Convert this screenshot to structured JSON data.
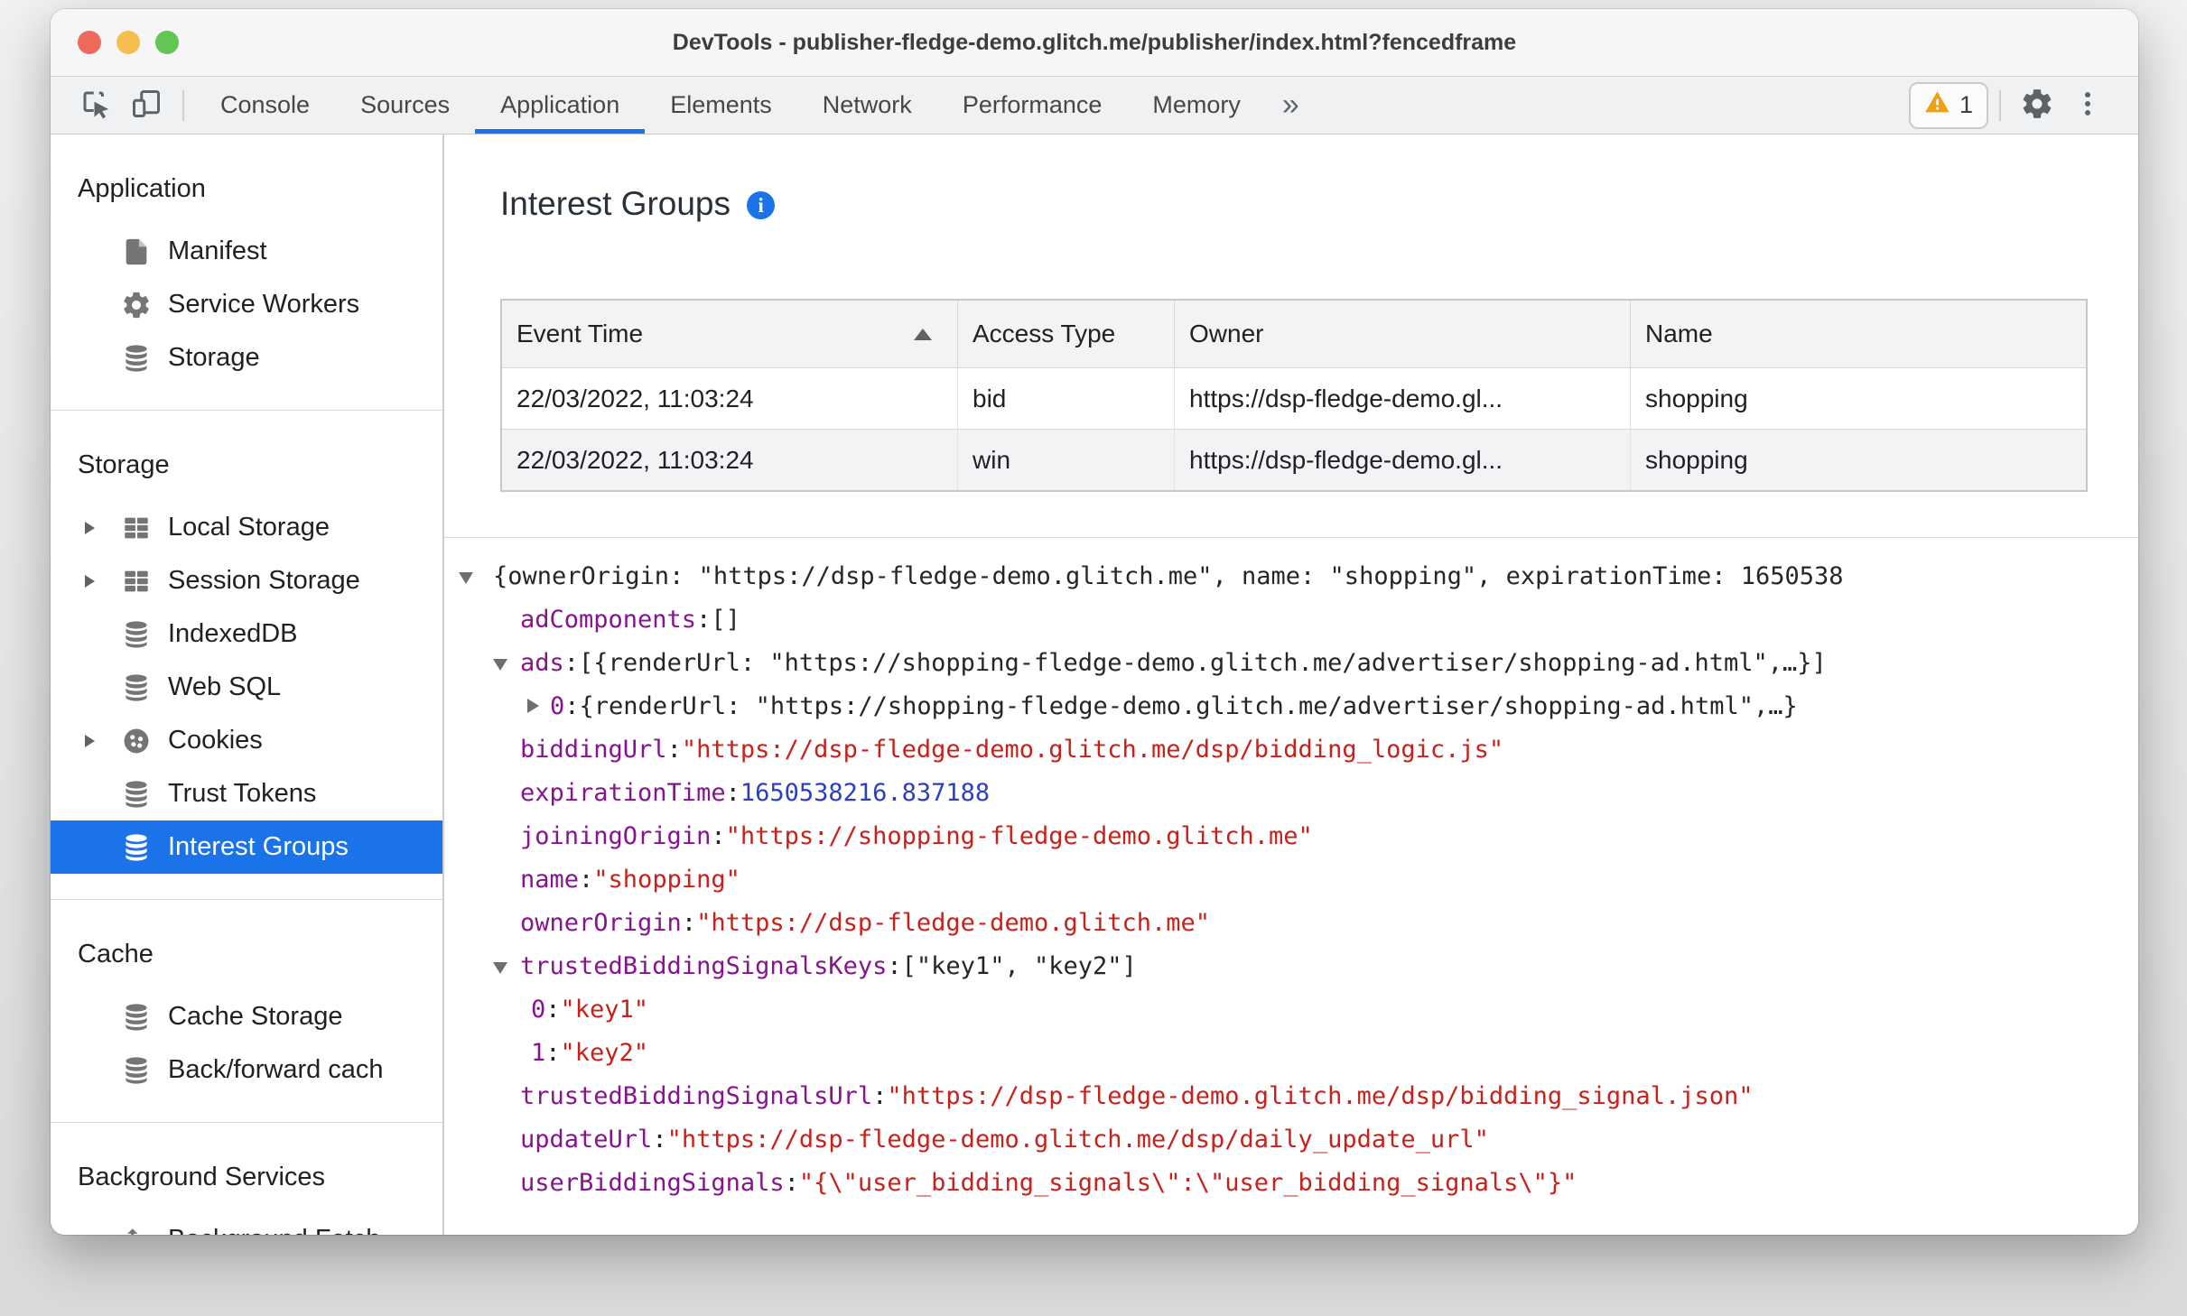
{
  "window": {
    "title": "DevTools - publisher-fledge-demo.glitch.me/publisher/index.html?fencedframe"
  },
  "toolbar": {
    "tabs": [
      {
        "label": "Console"
      },
      {
        "label": "Sources"
      },
      {
        "label": "Application",
        "selected": true
      },
      {
        "label": "Elements"
      },
      {
        "label": "Network"
      },
      {
        "label": "Performance"
      },
      {
        "label": "Memory"
      }
    ],
    "more_tabs_symbol": "»",
    "warning_badge_count": "1"
  },
  "sidebar": {
    "sections": [
      {
        "title": "Application",
        "items": [
          {
            "label": "Manifest",
            "icon": "document"
          },
          {
            "label": "Service Workers",
            "icon": "gear"
          },
          {
            "label": "Storage",
            "icon": "database"
          }
        ]
      },
      {
        "title": "Storage",
        "items": [
          {
            "label": "Local Storage",
            "icon": "grid",
            "expander": true
          },
          {
            "label": "Session Storage",
            "icon": "grid",
            "expander": true
          },
          {
            "label": "IndexedDB",
            "icon": "database"
          },
          {
            "label": "Web SQL",
            "icon": "database"
          },
          {
            "label": "Cookies",
            "icon": "cookie",
            "expander": true
          },
          {
            "label": "Trust Tokens",
            "icon": "database"
          },
          {
            "label": "Interest Groups",
            "icon": "database",
            "selected": true
          }
        ]
      },
      {
        "title": "Cache",
        "items": [
          {
            "label": "Cache Storage",
            "icon": "database"
          },
          {
            "label": "Back/forward cach",
            "icon": "database"
          }
        ]
      },
      {
        "title": "Background Services",
        "items": [
          {
            "label": "Background Fetch",
            "icon": "updown"
          }
        ]
      }
    ]
  },
  "main": {
    "heading": "Interest Groups",
    "table": {
      "columns": [
        {
          "label": "Event Time",
          "sorted": "asc"
        },
        {
          "label": "Access Type"
        },
        {
          "label": "Owner"
        },
        {
          "label": "Name"
        }
      ],
      "rows": [
        [
          "22/03/2022, 11:03:24",
          "bid",
          "https://dsp-fledge-demo.gl...",
          "shopping"
        ],
        [
          "22/03/2022, 11:03:24",
          "win",
          "https://dsp-fledge-demo.gl...",
          "shopping"
        ]
      ]
    },
    "tree": [
      {
        "indent": 0,
        "expander": "down",
        "key": null,
        "value": "{ownerOrigin: \"https://dsp-fledge-demo.glitch.me\", name: \"shopping\", expirationTime: 1650538",
        "type": "plain"
      },
      {
        "indent": 1,
        "expander": "none",
        "key": "adComponents",
        "value": "[]",
        "type": "plain"
      },
      {
        "indent": 1,
        "expander": "down",
        "key": "ads",
        "value": "[{renderUrl: \"https://shopping-fledge-demo.glitch.me/advertiser/shopping-ad.html\",…}]",
        "type": "plain"
      },
      {
        "indent": 2,
        "expander": "right",
        "key": "0",
        "value": "{renderUrl: \"https://shopping-fledge-demo.glitch.me/advertiser/shopping-ad.html\",…}",
        "type": "plain"
      },
      {
        "indent": 1,
        "expander": "none",
        "key": "biddingUrl",
        "value": "\"https://dsp-fledge-demo.glitch.me/dsp/bidding_logic.js\"",
        "type": "string"
      },
      {
        "indent": 1,
        "expander": "none",
        "key": "expirationTime",
        "value": "1650538216.837188",
        "type": "number"
      },
      {
        "indent": 1,
        "expander": "none",
        "key": "joiningOrigin",
        "value": "\"https://shopping-fledge-demo.glitch.me\"",
        "type": "string"
      },
      {
        "indent": 1,
        "expander": "none",
        "key": "name",
        "value": "\"shopping\"",
        "type": "string"
      },
      {
        "indent": 1,
        "expander": "none",
        "key": "ownerOrigin",
        "value": "\"https://dsp-fledge-demo.glitch.me\"",
        "type": "string"
      },
      {
        "indent": 1,
        "expander": "down",
        "key": "trustedBiddingSignalsKeys",
        "value": "[\"key1\", \"key2\"]",
        "type": "plain"
      },
      {
        "indent": 2,
        "expander": "hidden",
        "key": "0",
        "value": "\"key1\"",
        "type": "string"
      },
      {
        "indent": 2,
        "expander": "hidden",
        "key": "1",
        "value": "\"key2\"",
        "type": "string"
      },
      {
        "indent": 1,
        "expander": "none",
        "key": "trustedBiddingSignalsUrl",
        "value": "\"https://dsp-fledge-demo.glitch.me/dsp/bidding_signal.json\"",
        "type": "string"
      },
      {
        "indent": 1,
        "expander": "none",
        "key": "updateUrl",
        "value": "\"https://dsp-fledge-demo.glitch.me/dsp/daily_update_url\"",
        "type": "string"
      },
      {
        "indent": 1,
        "expander": "none",
        "key": "userBiddingSignals",
        "value": "\"{\\\"user_bidding_signals\\\":\\\"user_bidding_signals\\\"}\"",
        "type": "string"
      }
    ]
  },
  "colors": {
    "accent": "#1a73e8",
    "json_key": "#881391",
    "json_string": "#c9201a",
    "json_number": "#2a3fc1",
    "warning": "#f0a112",
    "traffic_close": "#ee6a5f",
    "traffic_minimize": "#f5be4f",
    "traffic_zoom": "#62c554"
  }
}
